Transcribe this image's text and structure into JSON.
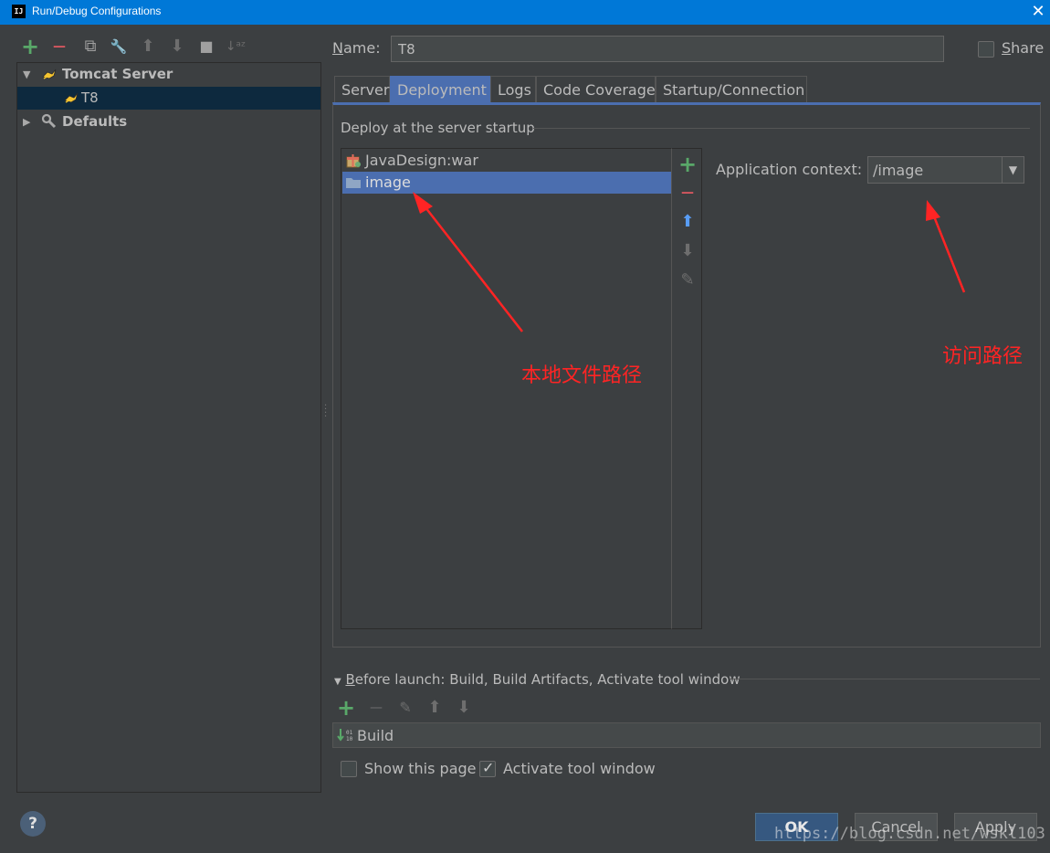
{
  "window": {
    "title": "Run/Debug Configurations",
    "app_icon_text": "IJ",
    "close_glyph": "✕"
  },
  "toolbar": {
    "add": "+",
    "remove": "—",
    "copy": "⧉",
    "edit_defaults": "🔧",
    "move_up": "⬆",
    "move_down": "⬇",
    "folder": "■",
    "sort": "↓ᵃᶻ"
  },
  "tree": {
    "items": [
      {
        "label": "Tomcat Server",
        "level": 0,
        "expanded": true
      },
      {
        "label": "T8",
        "level": 1,
        "selected": true
      },
      {
        "label": "Defaults",
        "level": 0,
        "expanded": false
      }
    ]
  },
  "name_field": {
    "label_mnemonic": "N",
    "label_rest": "ame:",
    "value": "T8"
  },
  "share": {
    "mnemonic": "S",
    "rest": "hare",
    "checked": false
  },
  "tabs": [
    {
      "label": "Server"
    },
    {
      "label": "Deployment",
      "active": true
    },
    {
      "label": "Logs"
    },
    {
      "label": "Code Coverage"
    },
    {
      "label": "Startup/Connection"
    }
  ],
  "deployment": {
    "section_title": "Deploy at the server startup",
    "items": [
      {
        "label": "JavaDesign:war",
        "icon": "artifact-icon"
      },
      {
        "label": "image",
        "icon": "folder-icon",
        "selected": true
      }
    ],
    "side_tools": {
      "add": "+",
      "remove": "—",
      "up": "⬆",
      "down": "⬇",
      "edit": "✎"
    },
    "context_label": "Application context:",
    "context_value": "/image"
  },
  "annotations": {
    "local_path": "本地文件路径",
    "access_path": "访问路径",
    "color": "#ff2424"
  },
  "before_launch": {
    "title_mnemonic": "B",
    "title_rest": "efore launch: Build, Build Artifacts, Activate tool window",
    "tools": {
      "add": "+",
      "remove": "—",
      "edit": "✎",
      "up": "⬆",
      "down": "⬇"
    },
    "items": [
      {
        "label": "Build"
      }
    ]
  },
  "options": {
    "show_page": {
      "label": "Show this page",
      "checked": false
    },
    "activate_tool_window": {
      "label": "Activate tool window",
      "checked": true
    }
  },
  "footer": {
    "help": "?",
    "ok": "OK",
    "cancel": "Cancel",
    "apply": "Apply",
    "watermark": "https://blog.csdn.net/wskl103"
  },
  "colors": {
    "accent": "#4b6eaf",
    "titlebar": "#0078d7",
    "selection": "#0d293e",
    "background": "#3c3f41"
  }
}
